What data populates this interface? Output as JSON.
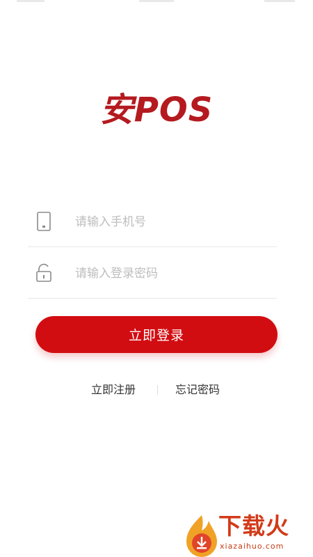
{
  "app": {
    "logo_text": "安POS",
    "brand_color": "#b41a1f"
  },
  "login_form": {
    "phone_placeholder": "请输入手机号",
    "phone_value": "",
    "password_placeholder": "请输入登录密码",
    "password_value": "",
    "submit_label": "立即登录",
    "accent_color": "#d20d12"
  },
  "links": {
    "register_label": "立即注册",
    "forgot_label": "忘记密码"
  },
  "icons": {
    "phone_field": "phone-icon",
    "password_field": "lock-icon",
    "watermark": "flame-download-icon"
  },
  "watermark": {
    "title": "下载火",
    "subtitle": "xiazaihuo.com"
  }
}
